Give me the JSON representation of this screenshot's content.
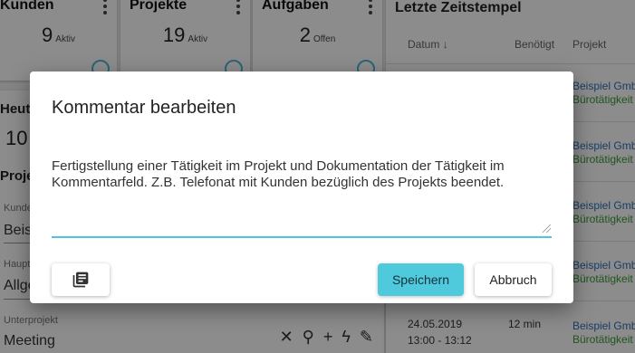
{
  "stats": [
    {
      "title": "Kunden",
      "value": "9",
      "unit": "Aktiv"
    },
    {
      "title": "Projekte",
      "value": "19",
      "unit": "Aktiv"
    },
    {
      "title": "Aufgaben",
      "value": "2",
      "unit": "Offen"
    }
  ],
  "today": {
    "label": "Heute",
    "value": "10"
  },
  "project_form": {
    "heading": "Proje",
    "customer": {
      "label": "Kunde",
      "value": "Beisp"
    },
    "main_project": {
      "label": "Haupt",
      "value": "Allge"
    },
    "sub_project": {
      "label": "Unterprojekt",
      "value": "Meeting"
    }
  },
  "timestamps": {
    "title": "Letzte Zeitstempel",
    "columns": {
      "date": "Datum",
      "needed": "Benötigt",
      "project": "Projekt"
    },
    "project_link": "Beispiel GmbH",
    "activity": "Bürotätigkeit",
    "last_row": {
      "date": "24.05.2019",
      "time": "13:00 - 13:12",
      "duration": "12 min"
    }
  },
  "dialog": {
    "title": "Kommentar bearbeiten",
    "comment": "Fertigstellung einer Tätigkeit im Projekt und Dokumentation der Tätigkeit im Kommentarfeld. Z.B. Telefonat mit Kunden bezüglich des Projekts beendet.",
    "save_label": "Speichern",
    "cancel_label": "Abbruch",
    "icon_button": "library-books-icon"
  },
  "colors": {
    "accent": "#4fc9dc",
    "link": "#2d6fb8",
    "activity": "#3a9a3a"
  }
}
